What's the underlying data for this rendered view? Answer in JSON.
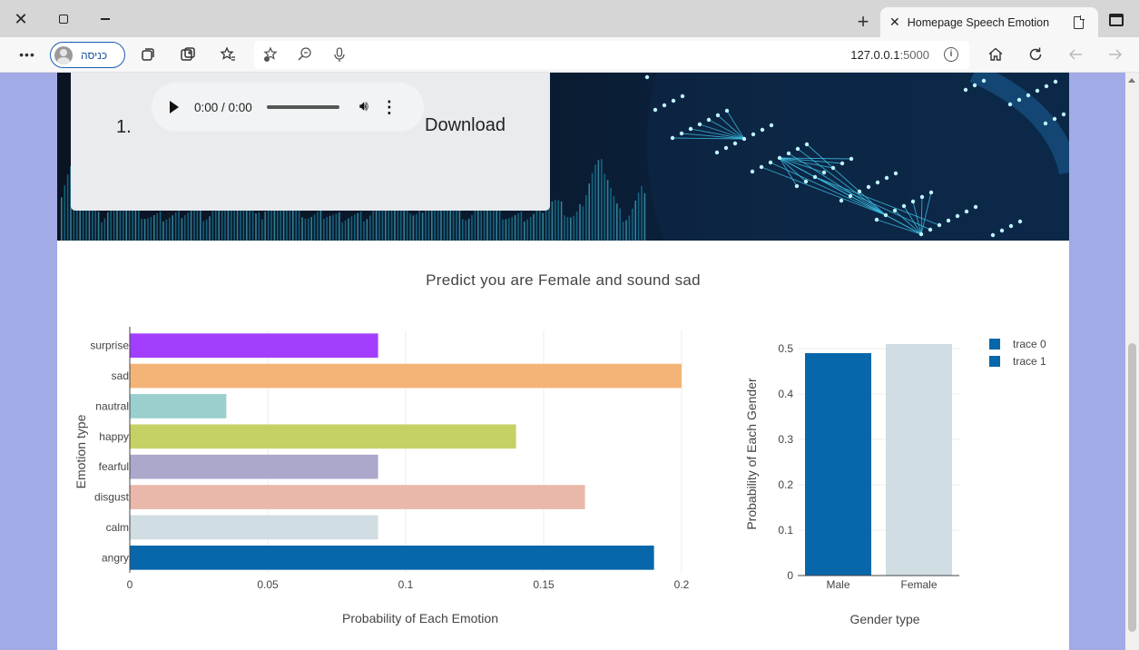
{
  "browser": {
    "tab_title": "Homepage Speech Emotion",
    "signin_label": "כניסה",
    "url_host": "127.0.0.1",
    "url_port": ":5000"
  },
  "audio": {
    "list_number": "1.",
    "time": "0:00 / 0:00",
    "download_label": "Download"
  },
  "prediction_text": "Predict you are Female and sound sad",
  "chart_data": [
    {
      "type": "bar",
      "orientation": "horizontal",
      "categories": [
        "angry",
        "calm",
        "disgust",
        "fearful",
        "happy",
        "nautral",
        "sad",
        "surprise"
      ],
      "values": [
        0.19,
        0.09,
        0.165,
        0.09,
        0.14,
        0.035,
        0.2,
        0.09
      ],
      "colors": [
        "#0866aa",
        "#d0dde3",
        "#e9b8aa",
        "#aba8cb",
        "#c5d165",
        "#9acfcd",
        "#f5b477",
        "#a33eff"
      ],
      "xlabel": "Probability of Each Emotion",
      "ylabel": "Emotion type",
      "xlim": [
        0,
        0.2
      ],
      "xticks": [
        "0",
        "0.05",
        "0.1",
        "0.15",
        "0.2"
      ],
      "grid": true
    },
    {
      "type": "bar",
      "categories": [
        "Male",
        "Female"
      ],
      "series": [
        {
          "name": "trace 0",
          "values": [
            0.49,
            null
          ],
          "color": "#0866aa"
        },
        {
          "name": "trace 1",
          "values": [
            null,
            0.51
          ],
          "color": "#d0dde3"
        }
      ],
      "xlabel": "Gender type",
      "ylabel": "Probability of Each Gender",
      "ylim": [
        0,
        0.51
      ],
      "yticks": [
        "0",
        "0.1",
        "0.2",
        "0.3",
        "0.4",
        "0.5"
      ],
      "legend": "top-right",
      "grid": true
    }
  ]
}
